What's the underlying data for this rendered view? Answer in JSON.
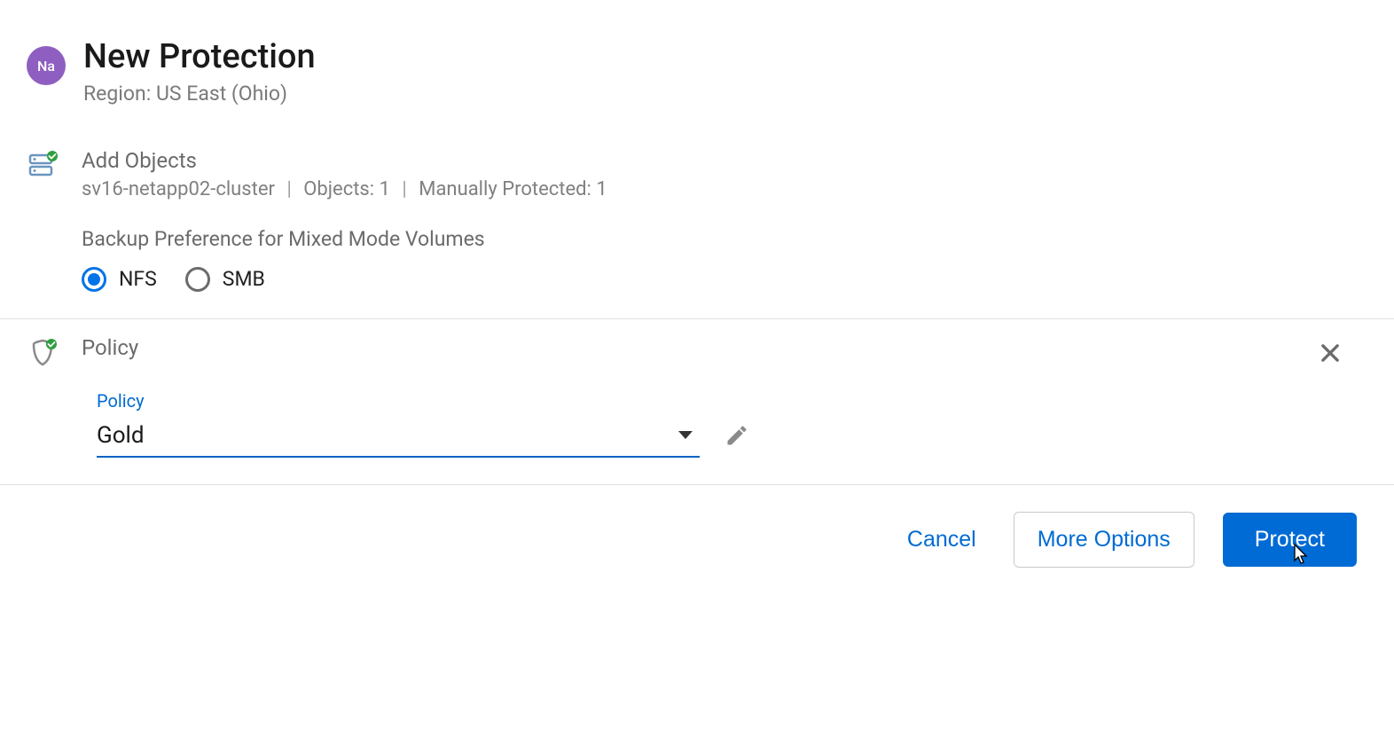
{
  "header": {
    "avatar_text": "Na",
    "title": "New Protection",
    "subtitle": "Region: US East (Ohio)"
  },
  "objects": {
    "title": "Add Objects",
    "cluster": "sv16-netapp02-cluster",
    "objects_label": "Objects: 1",
    "manual_label": "Manually Protected: 1",
    "backup_pref_label": "Backup Preference for Mixed Mode Volumes",
    "radio_nfs": "NFS",
    "radio_smb": "SMB"
  },
  "policy": {
    "section_title": "Policy",
    "field_label": "Policy",
    "selected_value": "Gold"
  },
  "footer": {
    "cancel": "Cancel",
    "more_options": "More Options",
    "protect": "Protect"
  }
}
